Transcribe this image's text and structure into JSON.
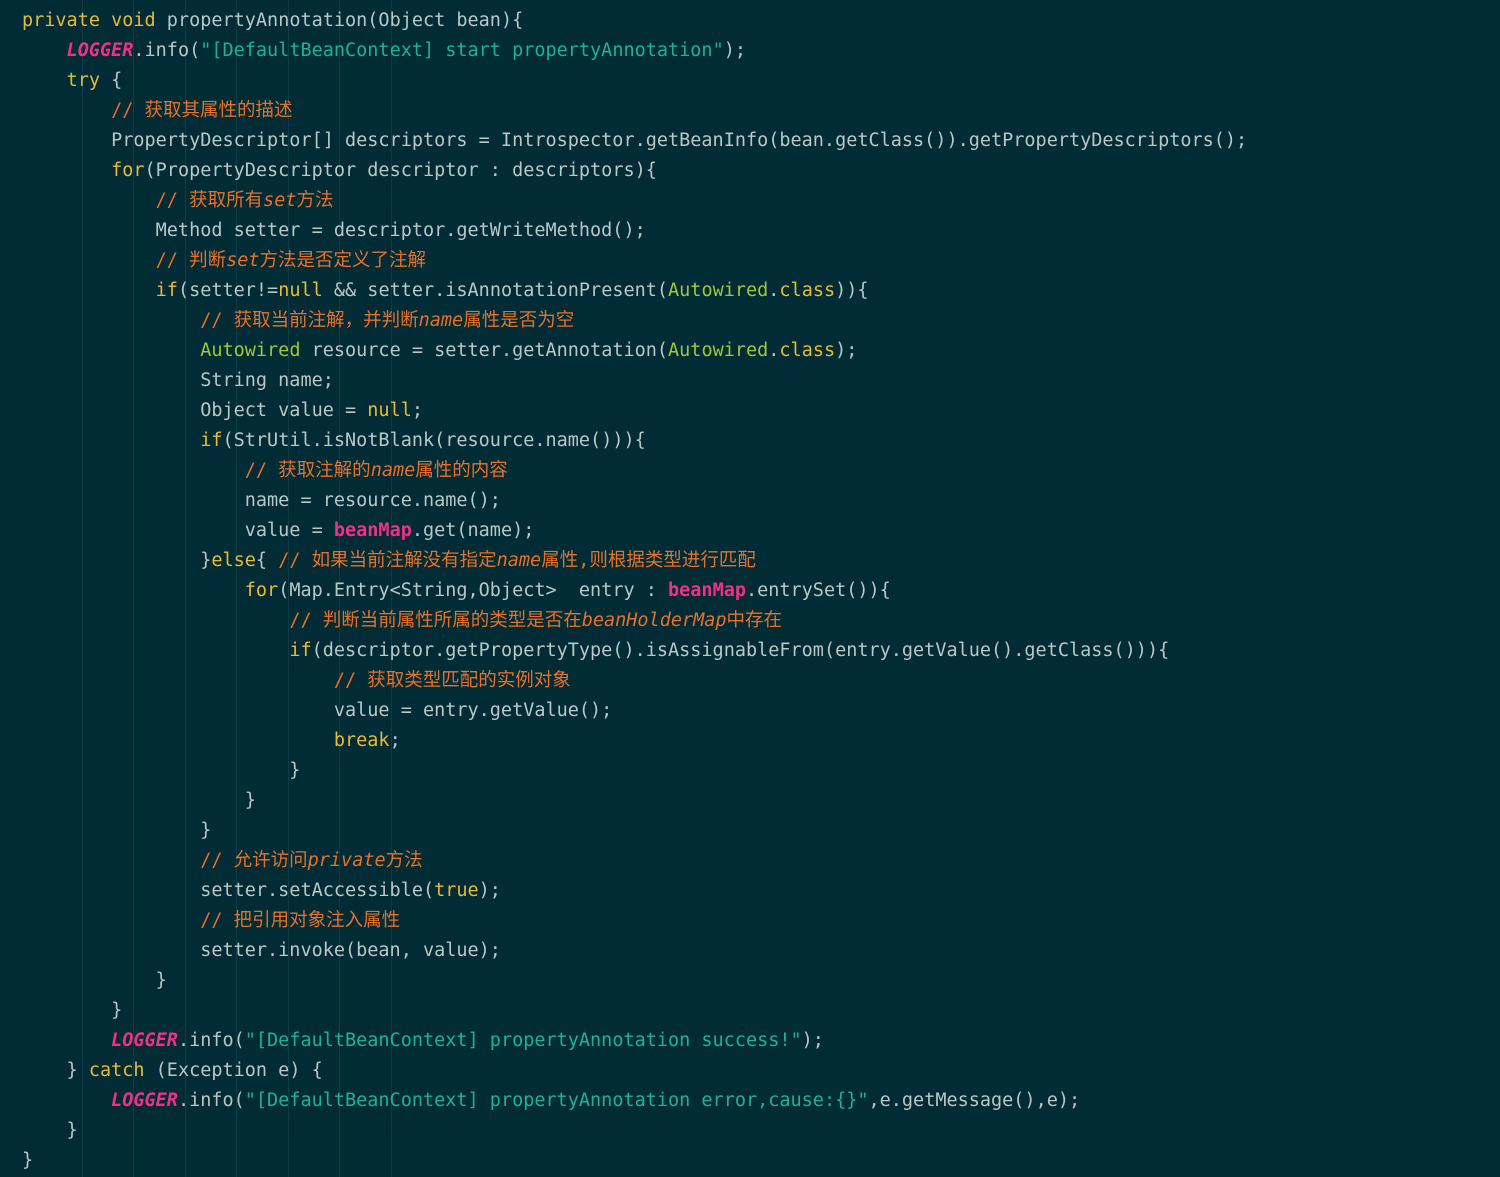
{
  "editor": {
    "language": "java",
    "background_color": "#012b35",
    "font_size_px": 18.5,
    "line_height_px": 30,
    "colors": {
      "plain": "#b9c7c9",
      "keyword": "#e8bb38",
      "string": "#1ab39a",
      "comment": "#e8702a",
      "static_field": "#f0308c",
      "instance_field": "#f0308c",
      "annotation_type": "#9fc83a",
      "indent_guide": "#0d3b46"
    },
    "method_signature": "private void propertyAnnotation(Object bean)",
    "total_lines": 39
  },
  "code": {
    "lines": [
      [
        [
          "kw",
          "private"
        ],
        [
          "pl",
          " "
        ],
        [
          "kw",
          "void"
        ],
        [
          "pl",
          " propertyAnnotation(Object bean){"
        ]
      ],
      [
        [
          "pl",
          "    "
        ],
        [
          "fld",
          "LOGGER"
        ],
        [
          "pl",
          ".info("
        ],
        [
          "str",
          "\"[DefaultBeanContext] start propertyAnnotation\""
        ],
        [
          "pl",
          ");"
        ]
      ],
      [
        [
          "pl",
          "    "
        ],
        [
          "kw",
          "try"
        ],
        [
          "pl",
          " {"
        ]
      ],
      [
        [
          "pl",
          "        "
        ],
        [
          "cm",
          "// 获取其属性的描述"
        ]
      ],
      [
        [
          "pl",
          "        PropertyDescriptor[] descriptors = Introspector.getBeanInfo(bean.getClass()).getPropertyDescriptors();"
        ]
      ],
      [
        [
          "pl",
          "        "
        ],
        [
          "kw",
          "for"
        ],
        [
          "pl",
          "(PropertyDescriptor descriptor : descriptors){"
        ]
      ],
      [
        [
          "pl",
          "            "
        ],
        [
          "cm",
          "// 获取所有"
        ],
        [
          "cmi",
          "set"
        ],
        [
          "cm",
          "方法"
        ]
      ],
      [
        [
          "pl",
          "            Method setter = descriptor.getWriteMethod();"
        ]
      ],
      [
        [
          "pl",
          "            "
        ],
        [
          "cm",
          "// 判断"
        ],
        [
          "cmi",
          "set"
        ],
        [
          "cm",
          "方法是否定义了注解"
        ]
      ],
      [
        [
          "pl",
          "            "
        ],
        [
          "kw",
          "if"
        ],
        [
          "pl",
          "(setter!="
        ],
        [
          "kw",
          "null"
        ],
        [
          "pl",
          " && setter.isAnnotationPresent("
        ],
        [
          "typ",
          "Autowired"
        ],
        [
          "pl",
          "."
        ],
        [
          "kw",
          "class"
        ],
        [
          "pl",
          ")){"
        ]
      ],
      [
        [
          "pl",
          "                "
        ],
        [
          "cm",
          "// 获取当前注解，并判断"
        ],
        [
          "cmi",
          "name"
        ],
        [
          "cm",
          "属性是否为空"
        ]
      ],
      [
        [
          "pl",
          "                "
        ],
        [
          "typ",
          "Autowired"
        ],
        [
          "pl",
          " resource = setter.getAnnotation("
        ],
        [
          "typ",
          "Autowired"
        ],
        [
          "pl",
          "."
        ],
        [
          "kw",
          "class"
        ],
        [
          "pl",
          ");"
        ]
      ],
      [
        [
          "pl",
          "                String name;"
        ]
      ],
      [
        [
          "pl",
          "                Object value = "
        ],
        [
          "kw",
          "null"
        ],
        [
          "pl",
          ";"
        ]
      ],
      [
        [
          "pl",
          "                "
        ],
        [
          "kw",
          "if"
        ],
        [
          "pl",
          "(StrUtil.isNotBlank(resource.name())){"
        ]
      ],
      [
        [
          "pl",
          "                    "
        ],
        [
          "cm",
          "// 获取注解的"
        ],
        [
          "cmi",
          "name"
        ],
        [
          "cm",
          "属性的内容"
        ]
      ],
      [
        [
          "pl",
          "                    name = resource.name();"
        ]
      ],
      [
        [
          "pl",
          "                    value = "
        ],
        [
          "fld2",
          "beanMap"
        ],
        [
          "pl",
          ".get(name);"
        ]
      ],
      [
        [
          "pl",
          "                }"
        ],
        [
          "kw",
          "else"
        ],
        [
          "pl",
          "{ "
        ],
        [
          "cm",
          "// 如果当前注解没有指定"
        ],
        [
          "cmi",
          "name"
        ],
        [
          "cm",
          "属性,则根据类型进行匹配"
        ]
      ],
      [
        [
          "pl",
          "                    "
        ],
        [
          "kw",
          "for"
        ],
        [
          "pl",
          "(Map.Entry<String,Object>  entry : "
        ],
        [
          "fld2",
          "beanMap"
        ],
        [
          "pl",
          ".entrySet()){"
        ]
      ],
      [
        [
          "pl",
          "                        "
        ],
        [
          "cm",
          "// 判断当前属性所属的类型是否在"
        ],
        [
          "cmi",
          "beanHolderMap"
        ],
        [
          "cm",
          "中存在"
        ]
      ],
      [
        [
          "pl",
          "                        "
        ],
        [
          "kw",
          "if"
        ],
        [
          "pl",
          "(descriptor.getPropertyType().isAssignableFrom(entry.getValue().getClass())){"
        ]
      ],
      [
        [
          "pl",
          "                            "
        ],
        [
          "cm",
          "// 获取类型匹配的实例对象"
        ]
      ],
      [
        [
          "pl",
          "                            value = entry.getValue();"
        ]
      ],
      [
        [
          "pl",
          "                            "
        ],
        [
          "kw",
          "break"
        ],
        [
          "pl",
          ";"
        ]
      ],
      [
        [
          "pl",
          "                        }"
        ]
      ],
      [
        [
          "pl",
          "                    }"
        ]
      ],
      [
        [
          "pl",
          "                }"
        ]
      ],
      [
        [
          "pl",
          "                "
        ],
        [
          "cm",
          "// 允许访问"
        ],
        [
          "cmi",
          "private"
        ],
        [
          "cm",
          "方法"
        ]
      ],
      [
        [
          "pl",
          "                setter.setAccessible("
        ],
        [
          "kw",
          "true"
        ],
        [
          "pl",
          ");"
        ]
      ],
      [
        [
          "pl",
          "                "
        ],
        [
          "cm",
          "// 把引用对象注入属性"
        ]
      ],
      [
        [
          "pl",
          "                setter.invoke(bean, value);"
        ]
      ],
      [
        [
          "pl",
          "            }"
        ]
      ],
      [
        [
          "pl",
          "        }"
        ]
      ],
      [
        [
          "pl",
          "        "
        ],
        [
          "fld",
          "LOGGER"
        ],
        [
          "pl",
          ".info("
        ],
        [
          "str",
          "\"[DefaultBeanContext] propertyAnnotation success!\""
        ],
        [
          "pl",
          ");"
        ]
      ],
      [
        [
          "pl",
          "    } "
        ],
        [
          "kw",
          "catch"
        ],
        [
          "pl",
          " (Exception e) {"
        ]
      ],
      [
        [
          "pl",
          "        "
        ],
        [
          "fld",
          "LOGGER"
        ],
        [
          "pl",
          ".info("
        ],
        [
          "str",
          "\"[DefaultBeanContext] propertyAnnotation error,cause:{}\""
        ],
        [
          "pl",
          ",e.getMessage(),e);"
        ]
      ],
      [
        [
          "pl",
          "    }"
        ]
      ],
      [
        [
          "pl",
          "}"
        ]
      ]
    ],
    "indent_guide_x": [
      82,
      133,
      185,
      236,
      288,
      339,
      391
    ]
  }
}
